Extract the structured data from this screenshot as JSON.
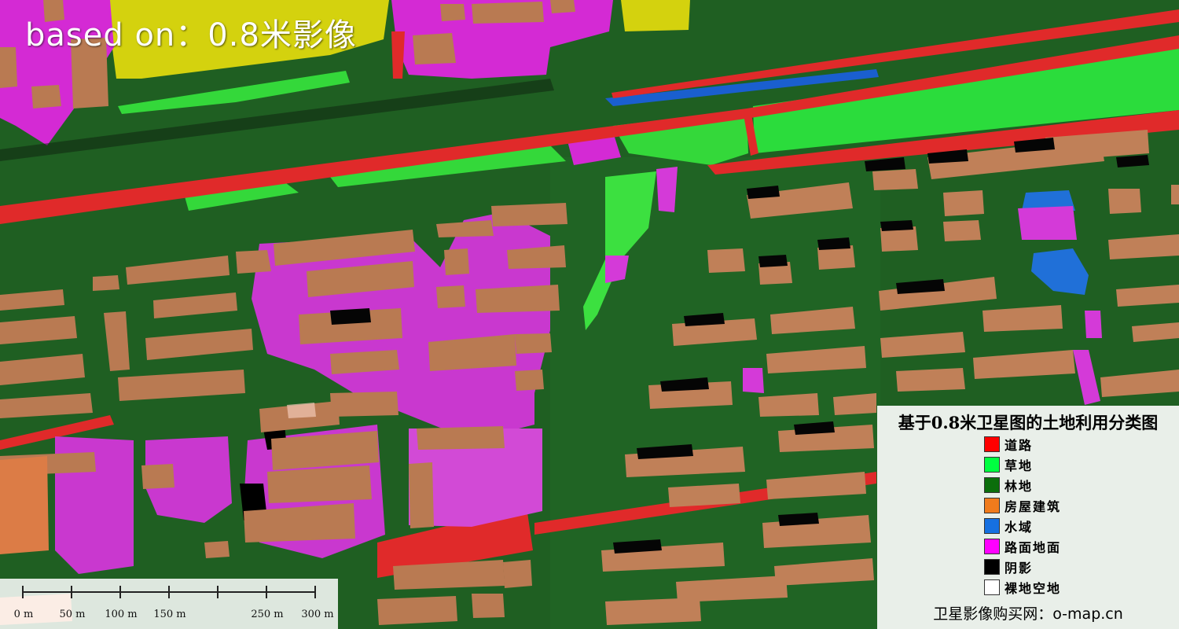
{
  "image_label": "based on：0.8米影像",
  "legend": {
    "title": "基于0.8米卫星图的土地利用分类图",
    "items": [
      {
        "label": "道路",
        "color": "#ff0000"
      },
      {
        "label": "草地",
        "color": "#00ff40"
      },
      {
        "label": "林地",
        "color": "#0b6e0b"
      },
      {
        "label": "房屋建筑",
        "color": "#f07b1c"
      },
      {
        "label": "水域",
        "color": "#1670e0"
      },
      {
        "label": "路面地面",
        "color": "#ff00ff"
      },
      {
        "label": "阴影",
        "color": "#000000"
      },
      {
        "label": "裸地空地",
        "color": "#ffffff"
      }
    ],
    "footer": "卫星影像购买网：o-map.cn"
  },
  "scale_bar": {
    "labels": [
      "0 m",
      "50 m",
      "100 m",
      "150 m",
      "250 m",
      "300 m"
    ]
  }
}
